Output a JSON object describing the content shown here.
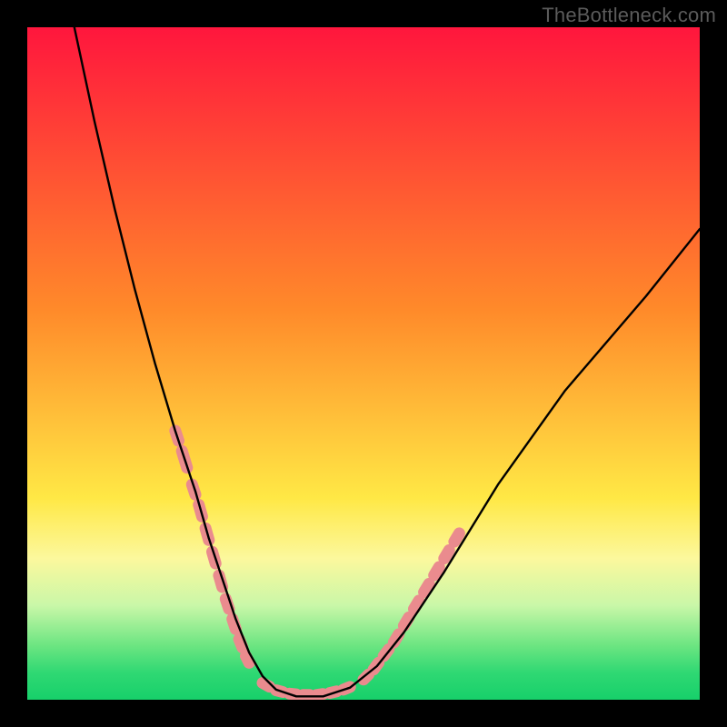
{
  "watermark": "TheBottleneck.com",
  "colors": {
    "page_bg": "#000000",
    "grad_top": "#ff163d",
    "grad_mid_upper": "#ff8a2a",
    "grad_mid": "#ffe845",
    "grad_band_light_yellow": "#fcf89d",
    "grad_band_pale": "#c9f7a8",
    "grad_band_green1": "#6be581",
    "grad_band_green2": "#2fd873",
    "grad_band_green3": "#17d06a",
    "curve": "#000000",
    "highlight": "#ea8b8e"
  },
  "chart_data": {
    "type": "line",
    "title": "",
    "xlabel": "",
    "ylabel": "",
    "xlim": [
      0,
      100
    ],
    "ylim": [
      0,
      100
    ],
    "series": [
      {
        "name": "bottleneck-curve",
        "x": [
          7,
          10,
          13,
          16,
          19,
          22,
          25,
          27,
          29,
          31,
          33,
          35,
          37,
          40,
          44,
          48,
          52,
          56,
          62,
          70,
          80,
          92,
          100
        ],
        "values": [
          100,
          86,
          73,
          61,
          50,
          40,
          31,
          24,
          18,
          12,
          7,
          3.5,
          1.5,
          0.5,
          0.5,
          1.8,
          5,
          10,
          19,
          32,
          46,
          60,
          70
        ]
      }
    ],
    "highlight_segments": [
      {
        "name": "left-descent-dashes",
        "points": [
          [
            22,
            40
          ],
          [
            23,
            37
          ],
          [
            24.5,
            32
          ],
          [
            25.5,
            29
          ],
          [
            26.5,
            25.5
          ],
          [
            27.5,
            22
          ],
          [
            28.5,
            18.5
          ],
          [
            29.5,
            15
          ],
          [
            30.5,
            12
          ],
          [
            31.5,
            9
          ],
          [
            32.5,
            6.5
          ],
          [
            33.5,
            4.5
          ]
        ]
      },
      {
        "name": "valley-floor",
        "points": [
          [
            35,
            2.5
          ],
          [
            37,
            1.4
          ],
          [
            39,
            0.9
          ],
          [
            41,
            0.7
          ],
          [
            43,
            0.7
          ],
          [
            45,
            1.0
          ],
          [
            47,
            1.5
          ],
          [
            49,
            2.3
          ]
        ]
      },
      {
        "name": "right-ascent-dashes",
        "points": [
          [
            50,
            3
          ],
          [
            51.5,
            4.5
          ],
          [
            53,
            6.5
          ],
          [
            54.5,
            8.5
          ],
          [
            56,
            11
          ],
          [
            57.5,
            13.5
          ],
          [
            59,
            16
          ],
          [
            60.5,
            18.5
          ],
          [
            62,
            21
          ],
          [
            63.5,
            23.5
          ],
          [
            65,
            26
          ]
        ]
      }
    ],
    "gradient_stops": [
      {
        "offset": 0.0,
        "color": "#ff163d"
      },
      {
        "offset": 0.42,
        "color": "#ff8a2a"
      },
      {
        "offset": 0.7,
        "color": "#ffe845"
      },
      {
        "offset": 0.79,
        "color": "#fcf89d"
      },
      {
        "offset": 0.86,
        "color": "#c9f7a8"
      },
      {
        "offset": 0.92,
        "color": "#6be581"
      },
      {
        "offset": 0.96,
        "color": "#2fd873"
      },
      {
        "offset": 1.0,
        "color": "#17d06a"
      }
    ]
  }
}
